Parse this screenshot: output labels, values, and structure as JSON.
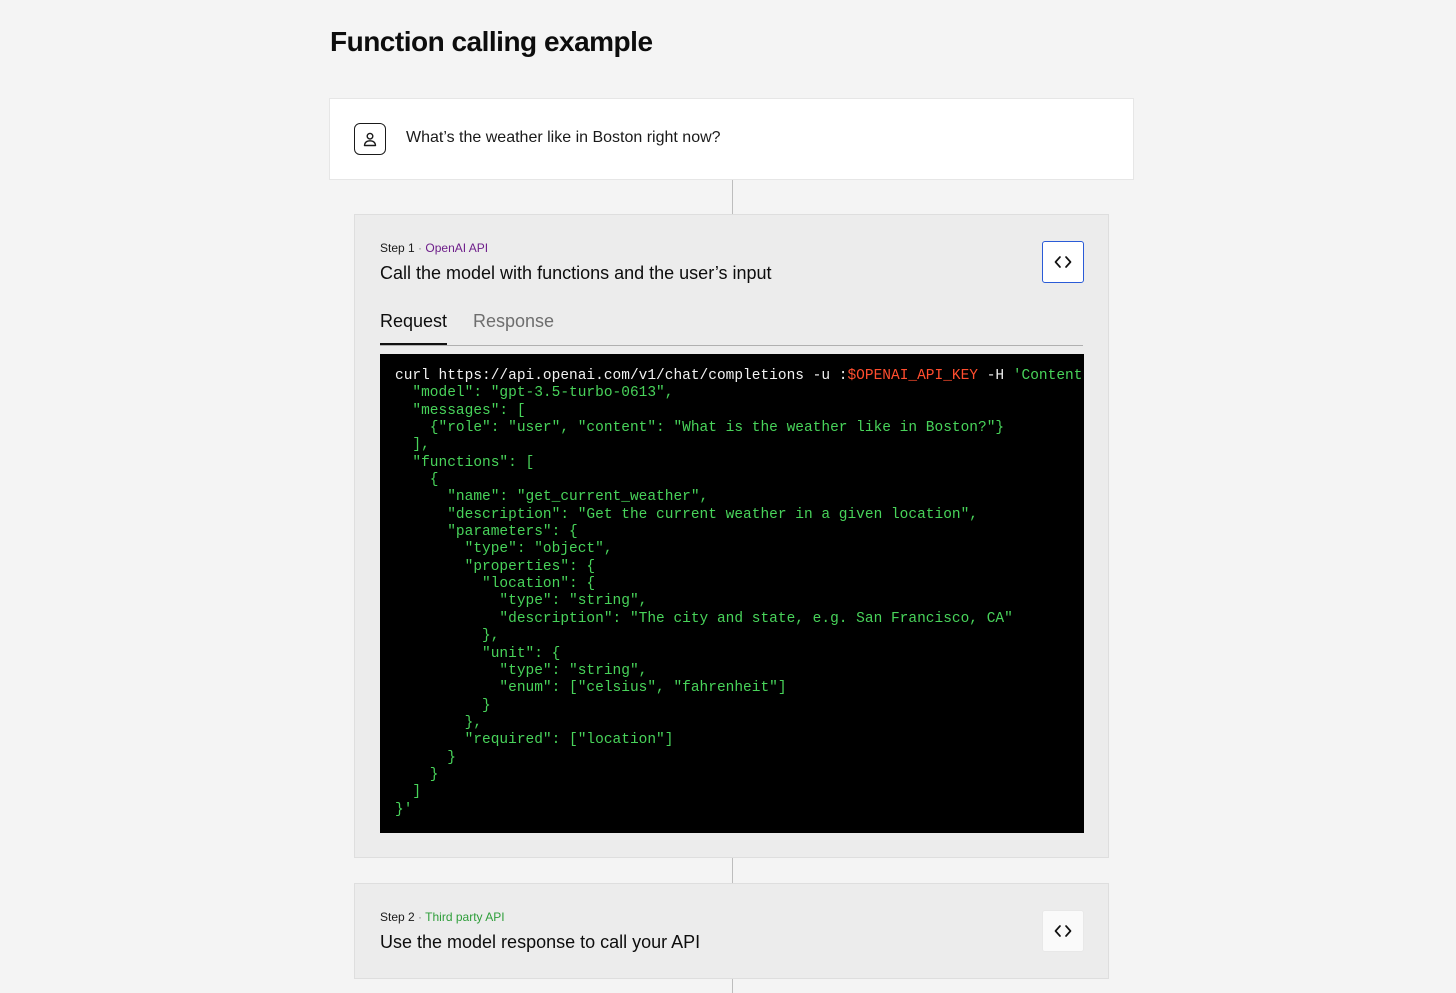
{
  "page": {
    "title": "Function calling example"
  },
  "user_message": {
    "text": "What’s the weather like in Boston right now?",
    "icon": "user-icon"
  },
  "steps": [
    {
      "number": "Step 1",
      "separator": "·",
      "source": "OpenAI API",
      "source_color": "#6e1e8a",
      "title": "Call the model with functions and the user’s input",
      "toggle_icon": "code-brackets-icon",
      "tabs": [
        {
          "label": "Request",
          "active": true
        },
        {
          "label": "Response",
          "active": false
        }
      ],
      "code": {
        "line1_cmd": "curl https://api.openai.com/v1/chat/completions -u :",
        "line1_var": "$OPENAI_API_KEY",
        "line1_flag": " -H ",
        "line1_str": "'Content-Type: application/json' -d '{",
        "body": "  \"model\": \"gpt-3.5-turbo-0613\",\n  \"messages\": [\n    {\"role\": \"user\", \"content\": \"What is the weather like in Boston?\"}\n  ],\n  \"functions\": [\n    {\n      \"name\": \"get_current_weather\",\n      \"description\": \"Get the current weather in a given location\",\n      \"parameters\": {\n        \"type\": \"object\",\n        \"properties\": {\n          \"location\": {\n            \"type\": \"string\",\n            \"description\": \"The city and state, e.g. San Francisco, CA\"\n          },\n          \"unit\": {\n            \"type\": \"string\",\n            \"enum\": [\"celsius\", \"fahrenheit\"]\n          }\n        },\n        \"required\": [\"location\"]\n      }\n    }\n  ]\n}'"
      }
    },
    {
      "number": "Step 2",
      "separator": "·",
      "source": "Third party API",
      "source_color": "#2e9e3a",
      "title": "Use the model response to call your API",
      "toggle_icon": "code-brackets-icon"
    }
  ],
  "colors": {
    "background": "#f4f4f4",
    "accent_blue": "#2a5bd7",
    "code_green": "#48d35a",
    "code_red": "#ff4d2e"
  }
}
